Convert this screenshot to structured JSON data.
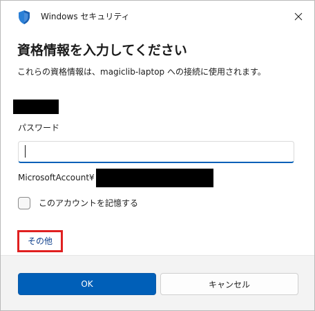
{
  "window": {
    "title": "Windows セキュリティ"
  },
  "dialog": {
    "heading": "資格情報を入力してください",
    "description": "これらの資格情報は、magiclib-laptop への接続に使用されます。",
    "password_label": "パスワード",
    "password_value": "",
    "account_prefix": "MicrosoftAccount¥",
    "remember_label": "このアカウントを記憶する",
    "remember_checked": false,
    "more_label": "その他",
    "ok_label": "OK",
    "cancel_label": "キャンセル"
  },
  "colors": {
    "accent": "#005fb8",
    "highlight_border": "#e02020",
    "footer_bg": "#f3f3f3"
  },
  "icons": {
    "app_icon": "shield-icon",
    "close_icon": "close-icon"
  }
}
